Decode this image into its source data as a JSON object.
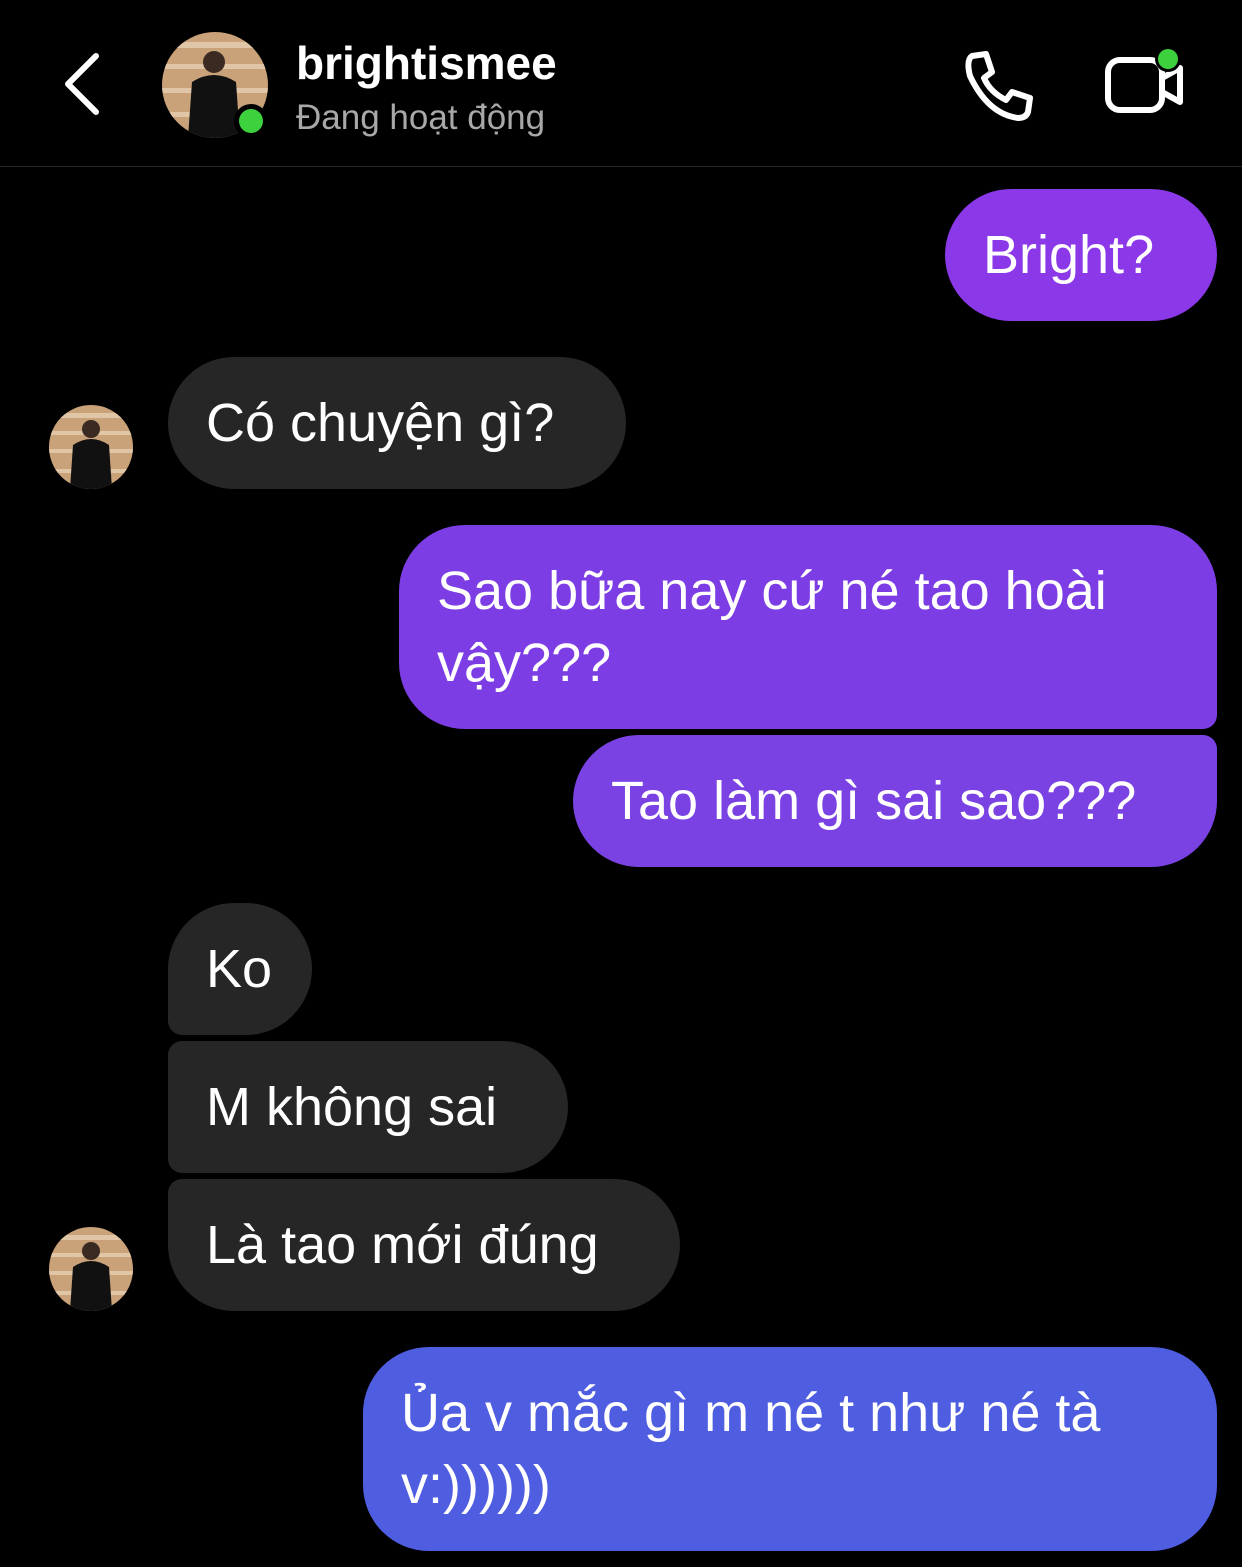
{
  "header": {
    "username": "brightismee",
    "status": "Đang hoạt động",
    "online_color": "#3dd13d",
    "icons": {
      "back": "chevron-left-icon",
      "call": "phone-icon",
      "video": "video-camera-icon"
    }
  },
  "messages": [
    {
      "id": "m1",
      "direction": "outgoing",
      "text": "Bright?",
      "color": "#8a38e8"
    },
    {
      "id": "m2",
      "direction": "incoming",
      "text": "Có chuyện gì?"
    },
    {
      "id": "m3",
      "direction": "outgoing",
      "text": "Sao bữa nay cứ né tao hoài vậy???",
      "color": "#7c3ee4"
    },
    {
      "id": "m4",
      "direction": "outgoing",
      "text": "Tao làm gì sai sao???",
      "color": "#7a42e3"
    },
    {
      "id": "m5",
      "direction": "incoming",
      "text": "Ko"
    },
    {
      "id": "m6",
      "direction": "incoming",
      "text": "M không sai"
    },
    {
      "id": "m7",
      "direction": "incoming",
      "text": "Là tao mới đúng"
    },
    {
      "id": "m8",
      "direction": "outgoing",
      "text": "Ủa v mắc gì m né t như né tà v:))))))",
      "color": "#4f5de0"
    }
  ],
  "colors": {
    "background": "#000000",
    "incoming_bubble": "#262626",
    "text": "#ffffff",
    "status_text": "#a8a8a8"
  }
}
